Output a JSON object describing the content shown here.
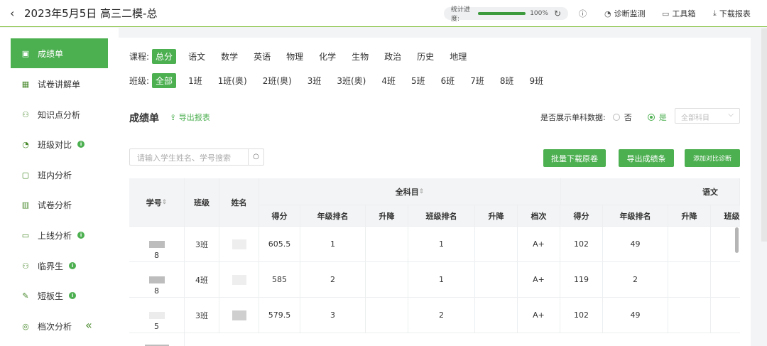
{
  "header": {
    "title": "2023年5月5日 高三二模-总",
    "progress_label": "统计进度:",
    "progress_value": "100%",
    "progress_fraction": 1.0,
    "buttons": [
      {
        "icon": "info-icon",
        "label": ""
      },
      {
        "icon": "monitor-icon",
        "label": "诊断监测"
      },
      {
        "icon": "toolbox-icon",
        "label": "工具箱"
      },
      {
        "icon": "download-icon",
        "label": "下载报表"
      }
    ]
  },
  "sidebar": {
    "items": [
      {
        "label": "成绩单",
        "icon": "scoresheet-icon",
        "active": true,
        "info": false
      },
      {
        "label": "试卷讲解单",
        "icon": "grid-icon",
        "active": false,
        "info": false
      },
      {
        "label": "知识点分析",
        "icon": "user-plus-icon",
        "active": false,
        "info": false
      },
      {
        "label": "班级对比",
        "icon": "pie-icon",
        "active": false,
        "info": true
      },
      {
        "label": "班内分析",
        "icon": "screen-icon",
        "active": false,
        "info": false
      },
      {
        "label": "试卷分析",
        "icon": "bar-chart-icon",
        "active": false,
        "info": false
      },
      {
        "label": "上线分析",
        "icon": "monitor-icon",
        "active": false,
        "info": true
      },
      {
        "label": "临界生",
        "icon": "user-plus-icon",
        "active": false,
        "info": true
      },
      {
        "label": "短板生",
        "icon": "pen-icon",
        "active": false,
        "info": true
      },
      {
        "label": "档次分析",
        "icon": "target-icon",
        "active": false,
        "info": false
      }
    ]
  },
  "filters": {
    "course_label": "课程:",
    "courses": [
      "总分",
      "语文",
      "数学",
      "英语",
      "物理",
      "化学",
      "生物",
      "政治",
      "历史",
      "地理"
    ],
    "class_label": "班级:",
    "classes": [
      "全部",
      "1班",
      "1班(奥)",
      "2班(奥)",
      "3班",
      "3班(奥)",
      "4班",
      "5班",
      "6班",
      "7班",
      "8班",
      "9班"
    ]
  },
  "section": {
    "title": "成绩单",
    "export_link": "导出报表",
    "single_subject_q": "是否展示单科数据:",
    "opt_no": "否",
    "opt_yes": "是",
    "select_placeholder": "全部科目",
    "search_placeholder": "请输入学生姓名、学号搜索",
    "btn_batch_download": "批量下载原卷",
    "btn_export_scores": "导出成绩条",
    "btn_add_compare": "添加对比诊断"
  },
  "table": {
    "col_id": "学号",
    "col_class": "班级",
    "col_name": "姓名",
    "group_all": "全科目",
    "group_chinese": "语文",
    "sub_headers": [
      "得分",
      "年级排名",
      "升降",
      "班级排名",
      "升降",
      "档次",
      "得分",
      "年级排名",
      "升降",
      "班级"
    ],
    "rows": [
      {
        "id": "8",
        "class": "3班",
        "score": "605.5",
        "grade_rank": "1",
        "grade_change": "",
        "class_rank": "1",
        "class_change": "",
        "level": "A+",
        "cn_score": "102",
        "cn_rank": "49"
      },
      {
        "id": "8",
        "class": "4班",
        "score": "585",
        "grade_rank": "2",
        "grade_change": "",
        "class_rank": "1",
        "class_change": "",
        "level": "A+",
        "cn_score": "119",
        "cn_rank": "2"
      },
      {
        "id": "5",
        "class": "3班",
        "score": "579.5",
        "grade_rank": "3",
        "grade_change": "",
        "class_rank": "2",
        "class_change": "",
        "level": "A+",
        "cn_score": "102",
        "cn_rank": "49"
      }
    ]
  }
}
